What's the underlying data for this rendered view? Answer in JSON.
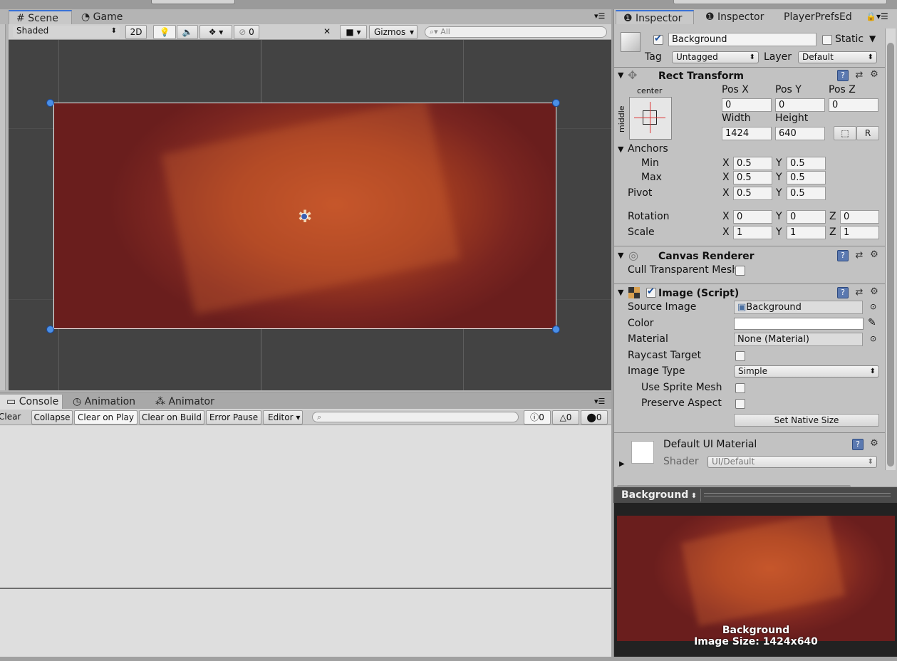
{
  "scene_tabs": [
    {
      "label": "Scene",
      "icon": "grid-icon"
    },
    {
      "label": "Game",
      "icon": "pacman-icon"
    }
  ],
  "scene_toolbar": {
    "shading": "Shaded",
    "mode_2d": "2D",
    "hidden_count": "0",
    "gizmos": "Gizmos",
    "search_placeholder": "All"
  },
  "bottom_tabs": [
    {
      "label": "Console",
      "icon": "console-icon"
    },
    {
      "label": "Animation",
      "icon": "clock-icon"
    },
    {
      "label": "Animator",
      "icon": "animator-icon"
    }
  ],
  "console_toolbar": {
    "clear": "Clear",
    "collapse": "Collapse",
    "clear_on_play": "Clear on Play",
    "clear_on_build": "Clear on Build",
    "error_pause": "Error Pause",
    "editor": "Editor",
    "info_count": "0",
    "warn_count": "0",
    "error_count": "0"
  },
  "inspector_tabs": [
    {
      "label": "Inspector",
      "icon": "info-icon"
    },
    {
      "label": "Inspector",
      "icon": "info-icon"
    },
    {
      "label": "PlayerPrefsEd",
      "icon": ""
    }
  ],
  "object": {
    "name": "Background",
    "static_label": "Static",
    "tag_label": "Tag",
    "tag_value": "Untagged",
    "layer_label": "Layer",
    "layer_value": "Default"
  },
  "rect_transform": {
    "title": "Rect Transform",
    "anchor_h": "center",
    "anchor_v": "middle",
    "pos_x_label": "Pos X",
    "pos_y_label": "Pos Y",
    "pos_z_label": "Pos Z",
    "pos_x": "0",
    "pos_y": "0",
    "pos_z": "0",
    "width_label": "Width",
    "height_label": "Height",
    "width": "1424",
    "height": "640",
    "raw_label": "R",
    "anchors_label": "Anchors",
    "min_label": "Min",
    "max_label": "Max",
    "min_x": "0.5",
    "min_y": "0.5",
    "max_x": "0.5",
    "max_y": "0.5",
    "pivot_label": "Pivot",
    "pivot_x": "0.5",
    "pivot_y": "0.5",
    "rotation_label": "Rotation",
    "rot_x": "0",
    "rot_y": "0",
    "rot_z": "0",
    "scale_label": "Scale",
    "scale_x": "1",
    "scale_y": "1",
    "scale_z": "1",
    "x": "X",
    "y": "Y",
    "z": "Z"
  },
  "canvas_renderer": {
    "title": "Canvas Renderer",
    "cull_label": "Cull Transparent Mesh"
  },
  "image_script": {
    "title": "Image (Script)",
    "source_image_label": "Source Image",
    "source_image": "Background",
    "color_label": "Color",
    "material_label": "Material",
    "material": "None (Material)",
    "raycast_label": "Raycast Target",
    "image_type_label": "Image Type",
    "image_type": "Simple",
    "sprite_mesh_label": "Use Sprite Mesh",
    "preserve_label": "Preserve Aspect",
    "native_size_button": "Set Native Size",
    "color_value": "#ffffff"
  },
  "material": {
    "name": "Default UI Material",
    "shader_label": "Shader",
    "shader_value": "UI/Default"
  },
  "preview": {
    "dropdown": "Background",
    "name": "Background",
    "size": "Image Size: 1424x640"
  }
}
